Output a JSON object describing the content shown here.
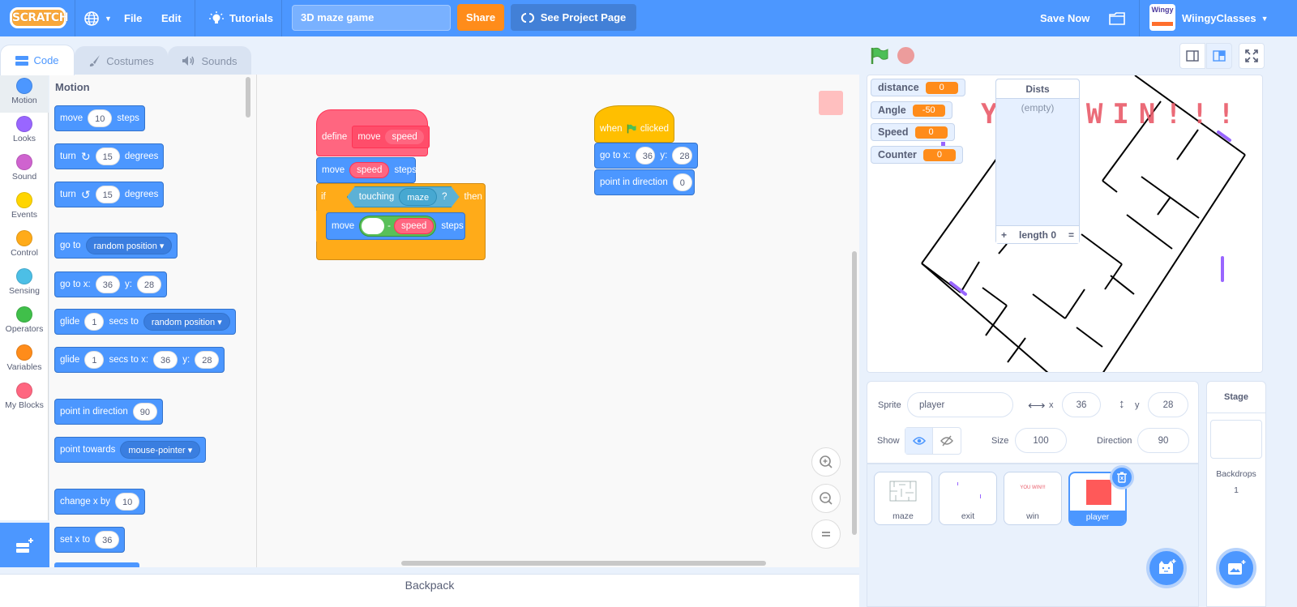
{
  "menubar": {
    "logo": "SCRATCH",
    "file": "File",
    "edit": "Edit",
    "tutorials": "Tutorials",
    "project_title": "3D maze game",
    "share": "Share",
    "see_project_page": "See Project Page",
    "save_now": "Save Now",
    "avatar_text": "Wingy",
    "username": "WiingyClasses"
  },
  "tabs": [
    {
      "label": "Code"
    },
    {
      "label": "Costumes"
    },
    {
      "label": "Sounds"
    }
  ],
  "categories": [
    {
      "label": "Motion",
      "color": "#4c97ff"
    },
    {
      "label": "Looks",
      "color": "#9966ff"
    },
    {
      "label": "Sound",
      "color": "#cf63cf"
    },
    {
      "label": "Events",
      "color": "#ffd500"
    },
    {
      "label": "Control",
      "color": "#ffab19"
    },
    {
      "label": "Sensing",
      "color": "#4cbfe6"
    },
    {
      "label": "Operators",
      "color": "#40bf4a"
    },
    {
      "label": "Variables",
      "color": "#ff8c1a"
    },
    {
      "label": "My Blocks",
      "color": "#ff6680"
    }
  ],
  "palette": {
    "title": "Motion",
    "move": {
      "a": "move",
      "v": "10",
      "b": "steps"
    },
    "turn_right": {
      "a": "turn",
      "v": "15",
      "b": "degrees"
    },
    "turn_left": {
      "a": "turn",
      "v": "15",
      "b": "degrees"
    },
    "goto": {
      "a": "go to",
      "dd": "random position"
    },
    "gotoxy": {
      "a": "go to x:",
      "x": "36",
      "b": "y:",
      "y": "28"
    },
    "glide": {
      "a": "glide",
      "v": "1",
      "b": "secs to",
      "dd": "random position"
    },
    "glidexy": {
      "a": "glide",
      "v": "1",
      "b": "secs to x:",
      "x": "36",
      "c": "y:",
      "y": "28"
    },
    "point_dir": {
      "a": "point in direction",
      "v": "90"
    },
    "point_towards": {
      "a": "point towards",
      "dd": "mouse-pointer"
    },
    "change_x": {
      "a": "change x by",
      "v": "10"
    },
    "set_x": {
      "a": "set x to",
      "v": "36"
    }
  },
  "script1": {
    "define": "define",
    "proc_name": "move",
    "proc_arg": "speed",
    "move1": {
      "a": "move",
      "arg": "speed",
      "b": "steps"
    },
    "if": "if",
    "touching": "touching",
    "touching_target": "maze",
    "question": "?",
    "then": "then",
    "move2": {
      "a": "move",
      "left": "",
      "op": "-",
      "arg": "speed",
      "b": "steps"
    }
  },
  "script2": {
    "when": "when",
    "clicked": "clicked",
    "gotoxy": {
      "a": "go to x:",
      "x": "36",
      "b": "y:",
      "y": "28"
    },
    "point_dir": {
      "a": "point in direction",
      "v": "0"
    }
  },
  "backpack": "Backpack",
  "monitors": [
    {
      "name": "distance",
      "value": "0"
    },
    {
      "name": "Angle",
      "value": "-50"
    },
    {
      "name": "Speed",
      "value": "0"
    },
    {
      "name": "Counter",
      "value": "0"
    }
  ],
  "list_monitor": {
    "title": "Dists",
    "empty": "(empty)",
    "add": "+",
    "length": "length 0",
    "resize": "="
  },
  "stage_text": "YOU WIN!!!",
  "sprite_info": {
    "sprite_label": "Sprite",
    "sprite_name": "player",
    "x_label": "x",
    "x": "36",
    "y_label": "y",
    "y": "28",
    "show_label": "Show",
    "size_label": "Size",
    "size": "100",
    "direction_label": "Direction",
    "direction": "90"
  },
  "sprites": [
    {
      "name": "maze"
    },
    {
      "name": "exit"
    },
    {
      "name": "win",
      "thumb_text": "YOU WIN!!!"
    },
    {
      "name": "player"
    }
  ],
  "stage_panel": {
    "title": "Stage",
    "backdrops_label": "Backdrops",
    "backdrops_count": "1"
  }
}
